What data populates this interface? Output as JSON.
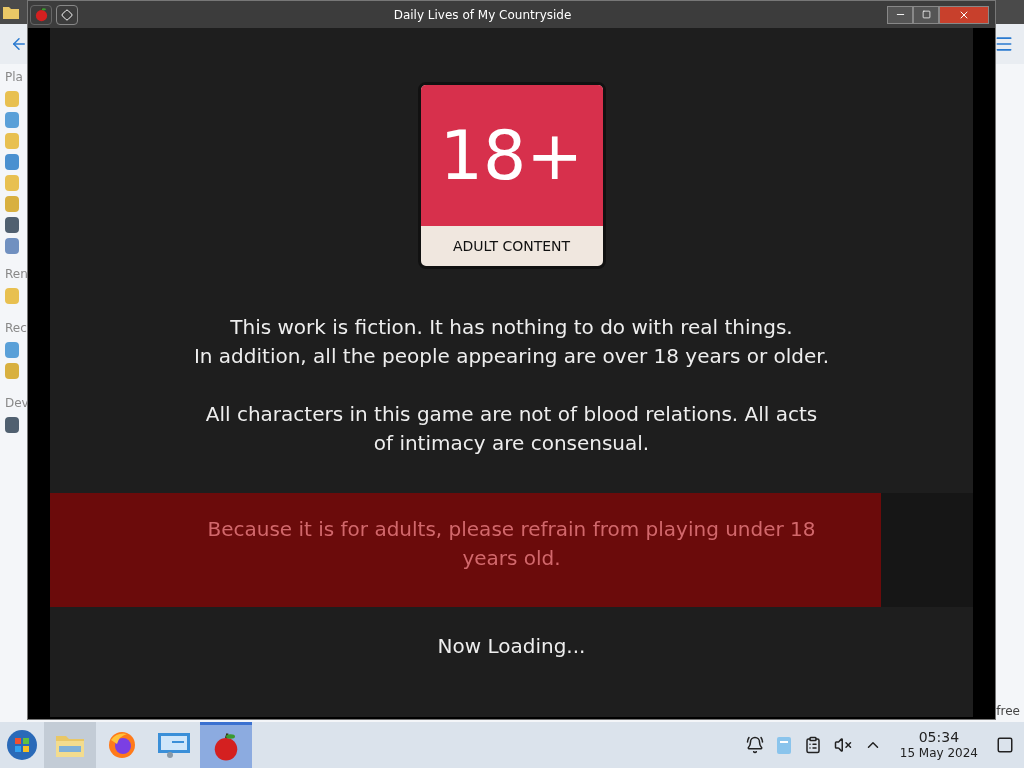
{
  "window": {
    "title": "Daily Lives of My Countryside"
  },
  "background_window": {
    "sidebar_labels": [
      "Pla",
      "Ren",
      "Rec",
      "Dev"
    ],
    "status_text": "free"
  },
  "badge": {
    "number": "18+",
    "caption": "ADULT CONTENT"
  },
  "paragraphs": [
    [
      "This work is fiction. It has nothing to do with real things.",
      "In addition, all the people appearing are over 18 years or older."
    ],
    [
      "All characters in this game are not of blood relations. All acts",
      "of intimacy are consensual."
    ]
  ],
  "warning": {
    "lines": [
      "Because it is for adults, please refrain from playing under 18",
      "years old."
    ],
    "level": 0.9
  },
  "loading": "Now Loading...",
  "taskbar": {
    "apps": [
      {
        "kind": "files",
        "selected": false,
        "hovered": true
      },
      {
        "kind": "browser",
        "selected": false,
        "hovered": false
      },
      {
        "kind": "settings",
        "selected": false,
        "hovered": false
      },
      {
        "kind": "apple",
        "selected": true,
        "hovered": false
      }
    ],
    "time": "05:34",
    "date": "15 May 2024"
  }
}
